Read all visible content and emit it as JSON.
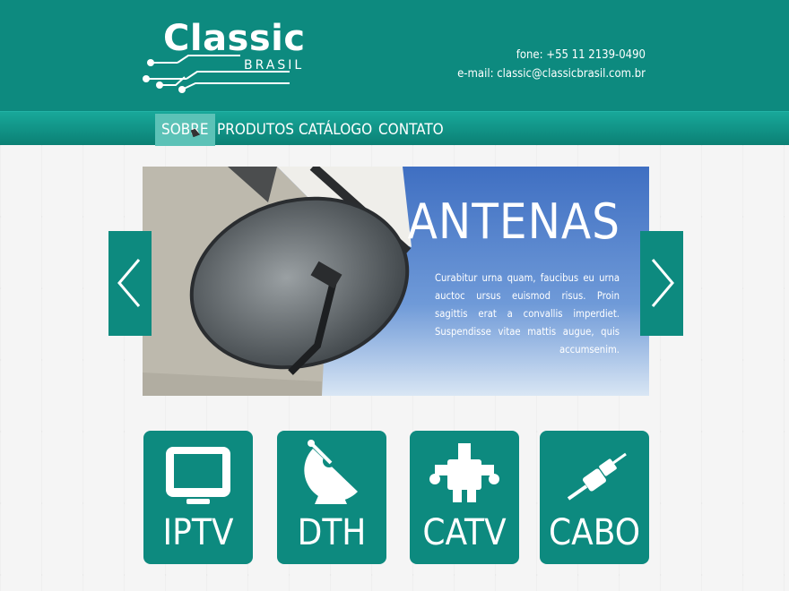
{
  "brand": {
    "title": "Classic",
    "subtitle": "BRASIL"
  },
  "contact": {
    "phone": "fone: +55 11 2139-0490",
    "email": "e-mail: classic@classicbrasil.com.br"
  },
  "nav": [
    "SOBRE",
    "PRODUTOS",
    "CATÁLOGO",
    "CONTATO"
  ],
  "slider": {
    "title": "ANTENAS",
    "text": "Curabitur urna quam, faucibus eu urna auctoc ursus euismod risus. Proin sagittis erat a convallis imperdiet. Suspendisse vitae mattis augue, quis accumsenim."
  },
  "services": [
    {
      "label": "IPTV",
      "icon": "tv-icon"
    },
    {
      "label": "DTH",
      "icon": "satellite-dish-icon"
    },
    {
      "label": "CATV",
      "icon": "splitter-icon"
    },
    {
      "label": "CABO",
      "icon": "cable-icon"
    }
  ],
  "colors": {
    "primary": "#0d8a7f",
    "nav_active": "#5cc2b7",
    "background": "#f4f4f4"
  }
}
